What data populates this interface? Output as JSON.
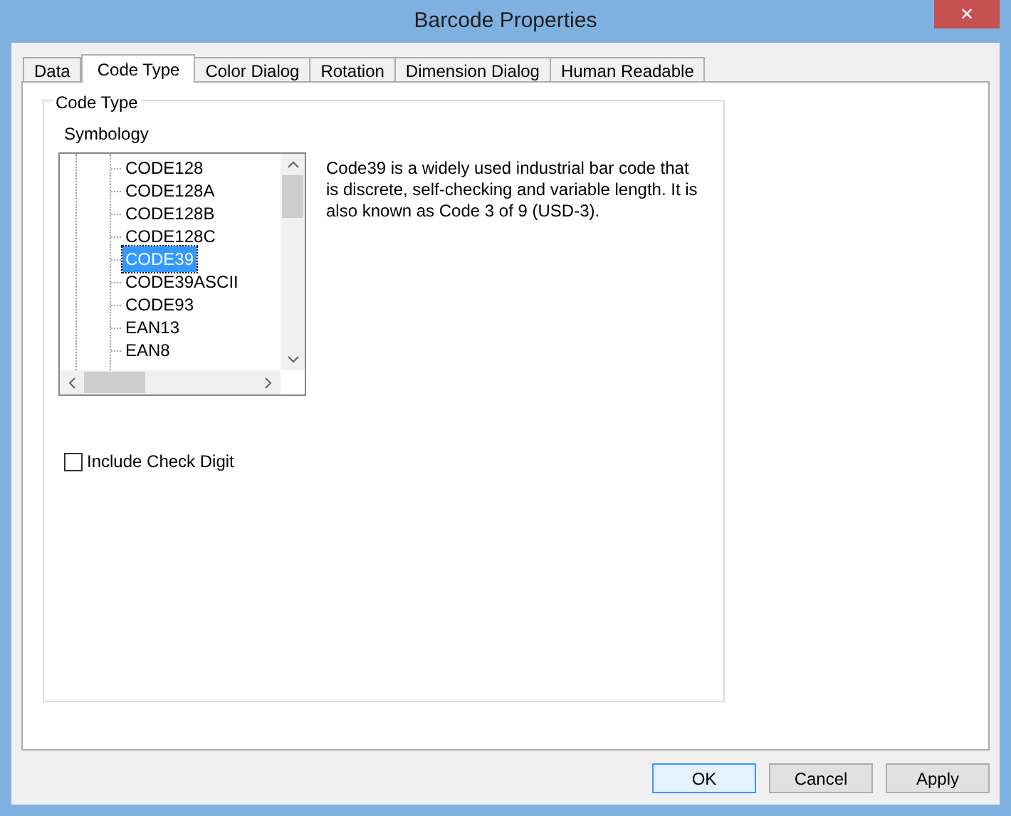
{
  "window": {
    "title": "Barcode Properties",
    "close": "✕"
  },
  "tabs": [
    {
      "label": "Data",
      "selected": false
    },
    {
      "label": "Code Type",
      "selected": true
    },
    {
      "label": "Color Dialog",
      "selected": false
    },
    {
      "label": "Rotation",
      "selected": false
    },
    {
      "label": "Dimension Dialog",
      "selected": false
    },
    {
      "label": "Human Readable",
      "selected": false
    }
  ],
  "group": {
    "title": "Code Type",
    "symbology_label": "Symbology",
    "symbologies": [
      {
        "label": "CODE128",
        "selected": false
      },
      {
        "label": "CODE128A",
        "selected": false
      },
      {
        "label": "CODE128B",
        "selected": false
      },
      {
        "label": "CODE128C",
        "selected": false
      },
      {
        "label": "CODE39",
        "selected": true
      },
      {
        "label": "CODE39ASCII",
        "selected": false
      },
      {
        "label": "CODE93",
        "selected": false
      },
      {
        "label": "EAN13",
        "selected": false
      },
      {
        "label": "EAN8",
        "selected": false
      }
    ],
    "description": "Code39 is a widely used industrial bar code that is discrete, self-checking and variable length. It is also known as Code 3 of 9 (USD-3).",
    "check_digit": {
      "label": "Include Check Digit",
      "checked": false
    }
  },
  "buttons": [
    {
      "label": "OK",
      "default": true
    },
    {
      "label": "Cancel",
      "default": false
    },
    {
      "label": "Apply",
      "default": false
    }
  ]
}
